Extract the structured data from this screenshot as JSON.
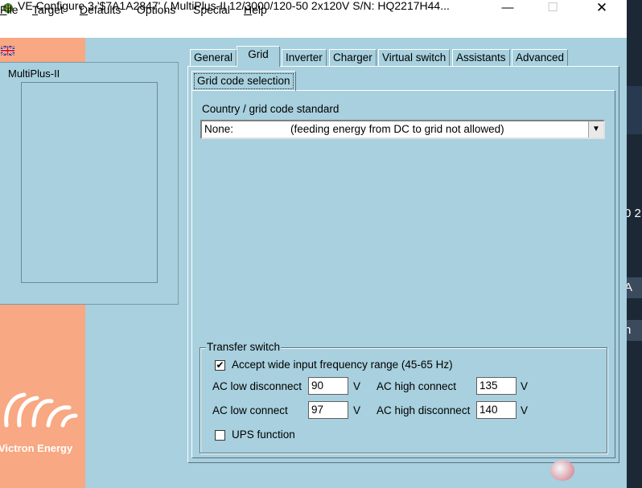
{
  "window": {
    "title": "VE Configure 3   '$7A1A2847' ( MultiPlus-II 12/3000/120-50 2x120V S/N: HQ2217H44...",
    "min_glyph": "—",
    "max_glyph": "☐",
    "close_glyph": "✕"
  },
  "menu": {
    "items": [
      {
        "underlined": "F",
        "rest": "ile"
      },
      {
        "underlined": "T",
        "rest": "arget"
      },
      {
        "underlined": "D",
        "rest": "efaults"
      },
      {
        "underlined": "",
        "rest": "Options"
      },
      {
        "underlined": "",
        "rest": "Special"
      },
      {
        "underlined": "H",
        "rest": "elp"
      }
    ]
  },
  "sidebar": {
    "tree_root": "MultiPlus-II",
    "brand_name": "Victron Energy"
  },
  "tabs": [
    "General",
    "Grid",
    "Inverter",
    "Charger",
    "Virtual switch",
    "Assistants",
    "Advanced"
  ],
  "active_tab": "Grid",
  "grid": {
    "sub_tab": "Grid code selection",
    "country_label": "Country / grid code standard",
    "selected_code": "None:",
    "selected_desc": "(feeding energy from DC to grid not allowed)"
  },
  "transfer_switch": {
    "legend": "Transfer switch",
    "wide_freq_label": "Accept wide input frequency range (45-65 Hz)",
    "wide_freq_checked": true,
    "ac_low_disconnect_label": "AC low disconnect",
    "ac_low_disconnect_value": "90",
    "ac_low_connect_label": "AC low connect",
    "ac_low_connect_value": "97",
    "ac_high_connect_label": "AC high connect",
    "ac_high_connect_value": "135",
    "ac_high_disconnect_label": "AC high disconnect",
    "ac_high_disconnect_value": "140",
    "unit": "V",
    "ups_label": "UPS function",
    "ups_checked": false
  },
  "background_window": {
    "text_1": "0 2",
    "text_2": "A",
    "text_3": "n"
  },
  "colors": {
    "panel": "#a8d0de",
    "brand_strip": "#f8a882"
  }
}
